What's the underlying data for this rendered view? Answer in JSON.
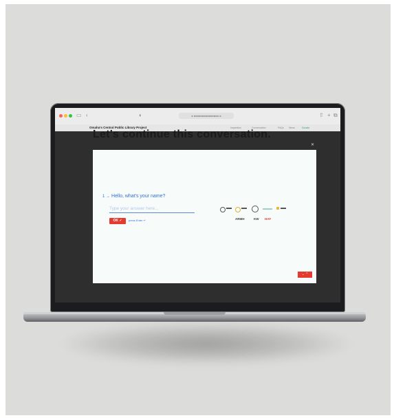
{
  "browser": {
    "url": "■ ■■■■■■■■■■■■■■■ ■",
    "icons": [
      "sidebar-icon",
      "back-icon",
      "shield-icon",
      "tabs-icon",
      "share-icon"
    ]
  },
  "site": {
    "brand": "Omaha's Central Public Library Project",
    "nav": [
      "Inspiration",
      "Conversation",
      "FAQs",
      "News",
      "Donate"
    ],
    "headline": "Let's continue this conversation."
  },
  "form": {
    "question_number": "1 →",
    "question": "Hello, what's your name?",
    "answer_placeholder": "Type your answer here...",
    "ok_label": "OK ✓",
    "press_enter": "press Enter ↵",
    "next_prev": "⌄ ⌃"
  },
  "logos": {
    "row2": [
      "ARMH",
      "KW",
      "HAF"
    ]
  },
  "colors": {
    "accent": "#e53a2f",
    "question": "#2f6ed8",
    "modal_bg": "#f7fbfa",
    "screen_bg": "#2e2e2f",
    "backdrop": "#dcdcdb"
  }
}
